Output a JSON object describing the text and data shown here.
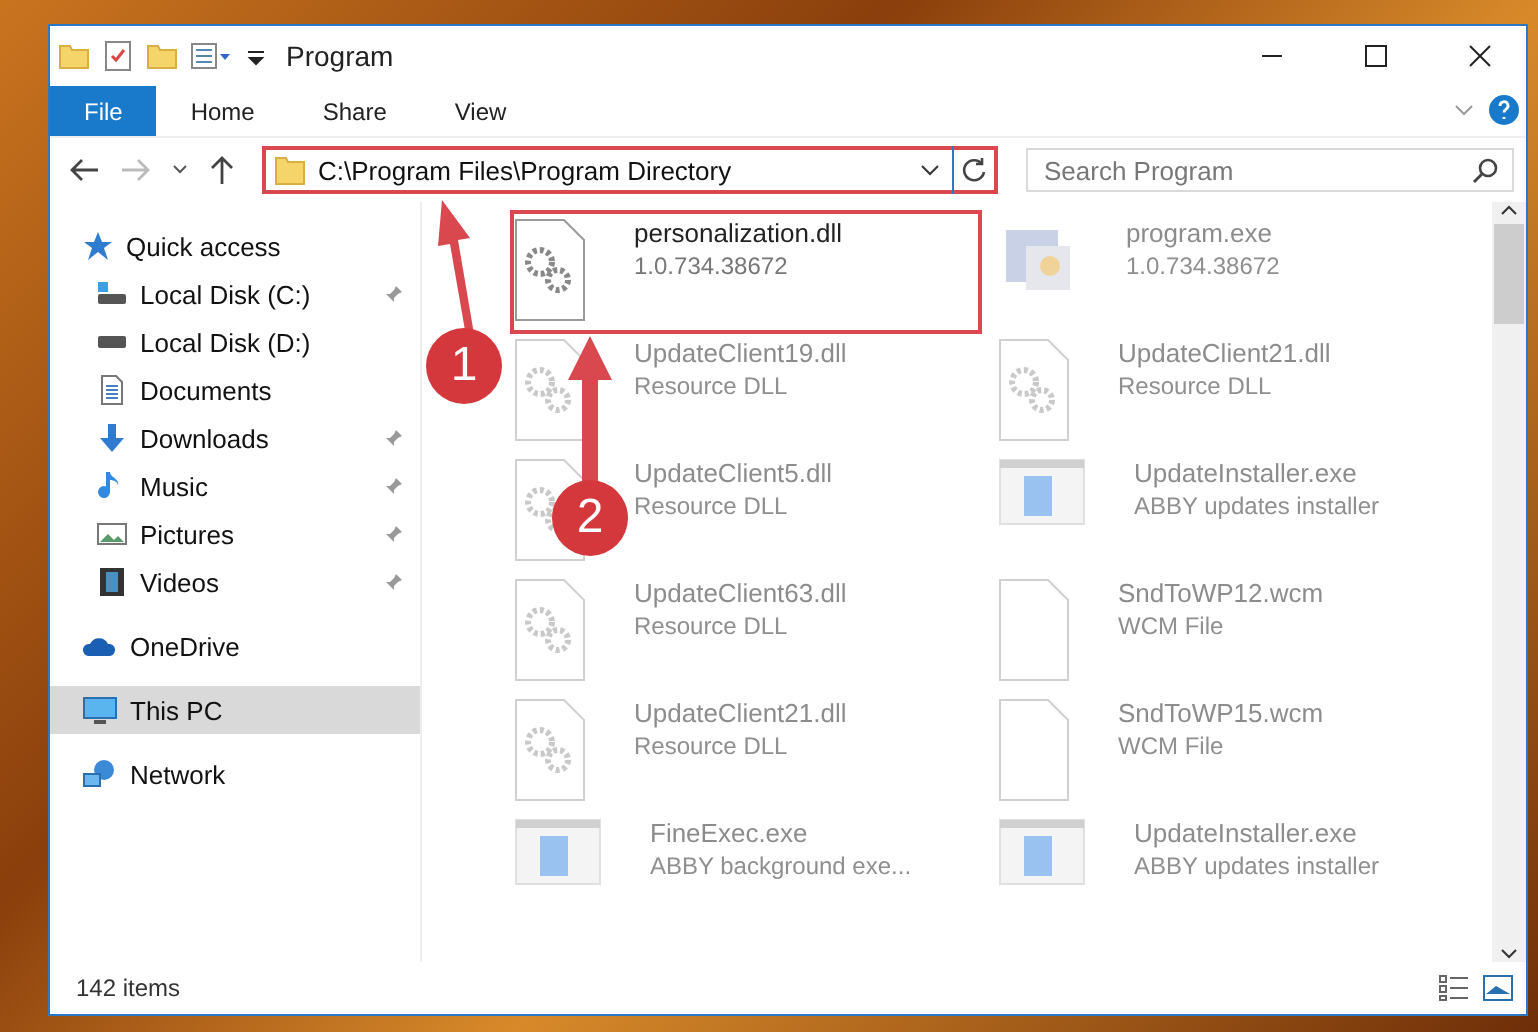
{
  "window": {
    "title": "Program"
  },
  "ribbon": {
    "tabs": [
      {
        "label": "File",
        "selected": true
      },
      {
        "label": "Home",
        "selected": false
      },
      {
        "label": "Share",
        "selected": false
      },
      {
        "label": "View",
        "selected": false
      }
    ]
  },
  "address_bar": {
    "path": "C:\\Program Files\\Program Directory",
    "highlighted": true
  },
  "search": {
    "placeholder": "Search Program"
  },
  "sidebar": {
    "items": [
      {
        "label": "Quick access",
        "kind": "star",
        "selected": false,
        "children": [
          {
            "label": "Local Disk (C:)",
            "kind": "disk-c",
            "selected": false,
            "pinned": true
          },
          {
            "label": "Local Disk (D:)",
            "kind": "disk",
            "selected": false,
            "pinned": false
          },
          {
            "label": "Documents",
            "kind": "documents",
            "selected": false,
            "pinned": false
          },
          {
            "label": "Downloads",
            "kind": "downloads",
            "selected": false,
            "pinned": true
          },
          {
            "label": "Music",
            "kind": "music",
            "selected": false,
            "pinned": true
          },
          {
            "label": "Pictures",
            "kind": "pictures",
            "selected": false,
            "pinned": true
          },
          {
            "label": "Videos",
            "kind": "videos",
            "selected": false,
            "pinned": true
          }
        ]
      },
      {
        "label": "OneDrive",
        "kind": "cloud",
        "selected": false
      },
      {
        "label": "This PC",
        "kind": "pc",
        "selected": true
      },
      {
        "label": "Network",
        "kind": "network",
        "selected": false
      }
    ]
  },
  "files": [
    {
      "name": "personalization.dll",
      "detail": "1.0.734.38672",
      "kind": "dll",
      "faded": false,
      "highlighted": true
    },
    {
      "name": "program.exe",
      "detail": "1.0.734.38672",
      "kind": "program",
      "faded": true
    },
    {
      "name": "UpdateClient19.dll",
      "detail": "Resource DLL",
      "kind": "dll",
      "faded": true
    },
    {
      "name": "UpdateClient21.dll",
      "detail": "Resource DLL",
      "kind": "dll",
      "faded": true
    },
    {
      "name": "UpdateClient5.dll",
      "detail": "Resource DLL",
      "kind": "dll",
      "faded": true
    },
    {
      "name": "UpdateInstaller.exe",
      "detail": "ABBY updates installer",
      "kind": "app",
      "faded": true
    },
    {
      "name": "UpdateClient63.dll",
      "detail": "Resource DLL",
      "kind": "dll",
      "faded": true
    },
    {
      "name": "SndToWP12.wcm",
      "detail": "WCM File",
      "kind": "file",
      "faded": true
    },
    {
      "name": "UpdateClient21.dll",
      "detail": "Resource DLL",
      "kind": "dll",
      "faded": true
    },
    {
      "name": "SndToWP15.wcm",
      "detail": "WCM File",
      "kind": "file",
      "faded": true
    },
    {
      "name": "FineExec.exe",
      "detail": "ABBY background exe...",
      "kind": "app",
      "faded": true
    },
    {
      "name": "UpdateInstaller.exe",
      "detail": "ABBY updates installer",
      "kind": "app",
      "faded": true
    }
  ],
  "status_bar": {
    "count": "142 items"
  },
  "annotations": [
    {
      "number": "1"
    },
    {
      "number": "2"
    }
  ]
}
